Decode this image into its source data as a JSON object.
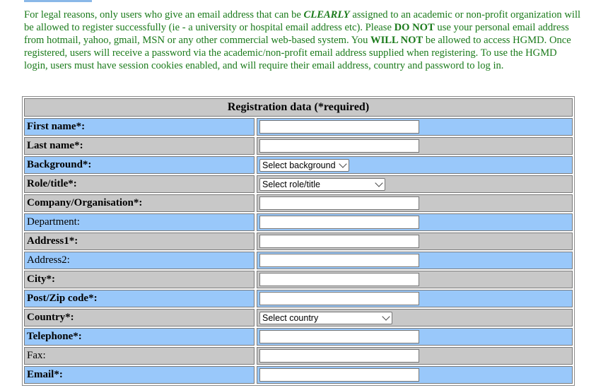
{
  "notice": {
    "p1": "For legal reasons, only users who give an email address that can be ",
    "clearly": "CLEARLY",
    "p2": " assigned to an academic or non-profit organization will be allowed to register successfully (ie - a university or hospital email address etc). Please ",
    "do_not": "DO NOT",
    "p3": " use your personal email address from hotmail, yahoo, gmail, MSN or any other commercial web-based system. You ",
    "will_not": "WILL NOT",
    "p4": " be allowed to access HGMD. Once registered, users will receive a password via the academic/non-profit email address supplied when registering. To use the HGMD login, users must have session cookies enabled, and will require their email address, country and password to log in."
  },
  "form": {
    "header": "Registration data (*required)",
    "fields": [
      {
        "label": "First name*:",
        "type": "text",
        "value": ""
      },
      {
        "label": "Last name*:",
        "type": "text",
        "value": ""
      },
      {
        "label": "Background*:",
        "type": "select",
        "value": "Select background"
      },
      {
        "label": "Role/title*:",
        "type": "select",
        "value": "Select role/title"
      },
      {
        "label": "Company/Organisation*:",
        "type": "text",
        "value": ""
      },
      {
        "label": "Department:",
        "type": "text",
        "value": ""
      },
      {
        "label": "Address1*:",
        "type": "text",
        "value": ""
      },
      {
        "label": "Address2:",
        "type": "text",
        "value": ""
      },
      {
        "label": "City*:",
        "type": "text",
        "value": ""
      },
      {
        "label": "Post/Zip code*:",
        "type": "text",
        "value": ""
      },
      {
        "label": "Country*:",
        "type": "select",
        "value": "Select country"
      },
      {
        "label": "Telephone*:",
        "type": "text",
        "value": ""
      },
      {
        "label": "Fax:",
        "type": "text",
        "value": ""
      },
      {
        "label": "Email*:",
        "type": "text",
        "value": ""
      }
    ]
  },
  "colors": {
    "notice_text": "#1a7a1a",
    "row_blue": "#99c8fa",
    "row_grey": "#c8c8c8"
  }
}
